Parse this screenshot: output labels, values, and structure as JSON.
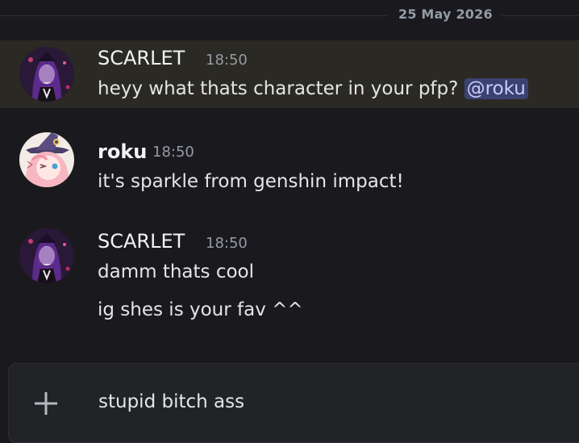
{
  "date_divider": "25 May 2026",
  "messages": [
    {
      "author": "SCARLET",
      "time": "18:50",
      "text": "heyy what thats character in your pfp?",
      "mention": "@roku",
      "highlighted": true
    },
    {
      "author": "roku",
      "time": "18:50",
      "text": "it's sparkle from genshin impact!"
    },
    {
      "author": "SCARLET",
      "time": "18:50",
      "lines": [
        "damm thats cool",
        "ig shes is your fav ^^"
      ]
    }
  ],
  "composer": {
    "value": "stupid bitch ass"
  },
  "colors": {
    "background": "#1a1a1e",
    "highlight": "#2b2923",
    "mention_bg": "#3c4270",
    "mention_text": "#c9cdfb",
    "timestamp": "#949ba4"
  },
  "icons": {
    "attach": "plus-icon"
  }
}
